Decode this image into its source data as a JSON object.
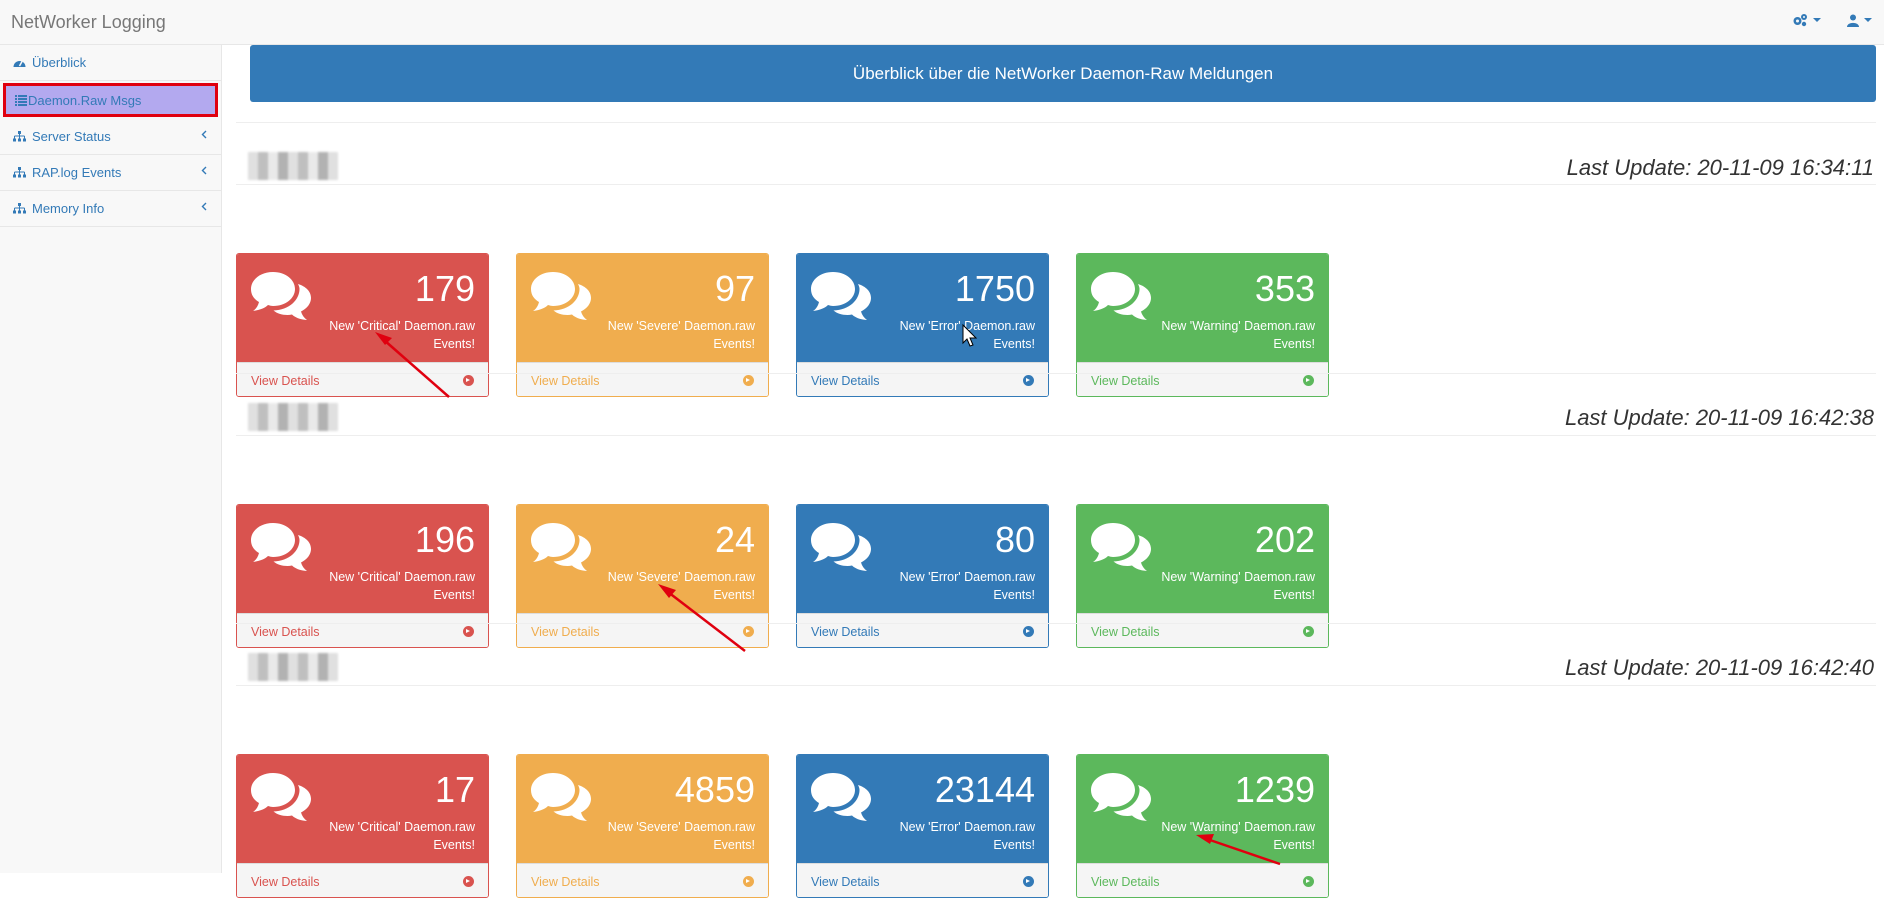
{
  "app": {
    "title": "NetWorker Logging"
  },
  "navbar": {
    "settings_icon": "cogs-icon",
    "user_icon": "user-icon"
  },
  "sidebar": {
    "items": [
      {
        "label": "Überblick",
        "icon": "dashboard-icon"
      },
      {
        "label": "Daemon.Raw Msgs",
        "icon": "list-icon"
      },
      {
        "label": "Server Status",
        "icon": "sitemap-icon"
      },
      {
        "label": "RAP.log Events",
        "icon": "sitemap-icon"
      },
      {
        "label": "Memory Info",
        "icon": "sitemap-icon"
      }
    ]
  },
  "main": {
    "banner": "Überblick über die NetWorker Daemon-Raw Meldungen",
    "sections": [
      {
        "last_update": "Last Update: 20-11-09 16:34:11",
        "panels": [
          {
            "count": "179",
            "line1": "New 'Critical' Daemon.raw",
            "line2": "Events!",
            "footer": "View Details"
          },
          {
            "count": "97",
            "line1": "New 'Severe' Daemon.raw",
            "line2": "Events!",
            "footer": "View Details"
          },
          {
            "count": "1750",
            "line1": "New 'Error' Daemon.raw",
            "line2": "Events!",
            "footer": "View Details"
          },
          {
            "count": "353",
            "line1": "New 'Warning' Daemon.raw",
            "line2": "Events!",
            "footer": "View Details"
          }
        ]
      },
      {
        "last_update": "Last Update: 20-11-09 16:42:38",
        "panels": [
          {
            "count": "196",
            "line1": "New 'Critical' Daemon.raw",
            "line2": "Events!",
            "footer": "View Details"
          },
          {
            "count": "24",
            "line1": "New 'Severe' Daemon.raw",
            "line2": "Events!",
            "footer": "View Details"
          },
          {
            "count": "80",
            "line1": "New 'Error' Daemon.raw",
            "line2": "Events!",
            "footer": "View Details"
          },
          {
            "count": "202",
            "line1": "New 'Warning' Daemon.raw",
            "line2": "Events!",
            "footer": "View Details"
          }
        ]
      },
      {
        "last_update": "Last Update: 20-11-09 16:42:40",
        "panels": [
          {
            "count": "17",
            "line1": "New 'Critical' Daemon.raw",
            "line2": "Events!",
            "footer": "View Details"
          },
          {
            "count": "4859",
            "line1": "New 'Severe' Daemon.raw",
            "line2": "Events!",
            "footer": "View Details"
          },
          {
            "count": "23144",
            "line1": "New 'Error' Daemon.raw",
            "line2": "Events!",
            "footer": "View Details"
          },
          {
            "count": "1239",
            "line1": "New 'Warning' Daemon.raw",
            "line2": "Events!",
            "footer": "View Details"
          }
        ]
      }
    ]
  },
  "colors": {
    "critical": "#d9534f",
    "severe": "#f0ad4e",
    "error": "#337ab7",
    "warning": "#5cb85c",
    "annotation": "#e0000f",
    "active_highlight": "#b3a9ef"
  }
}
